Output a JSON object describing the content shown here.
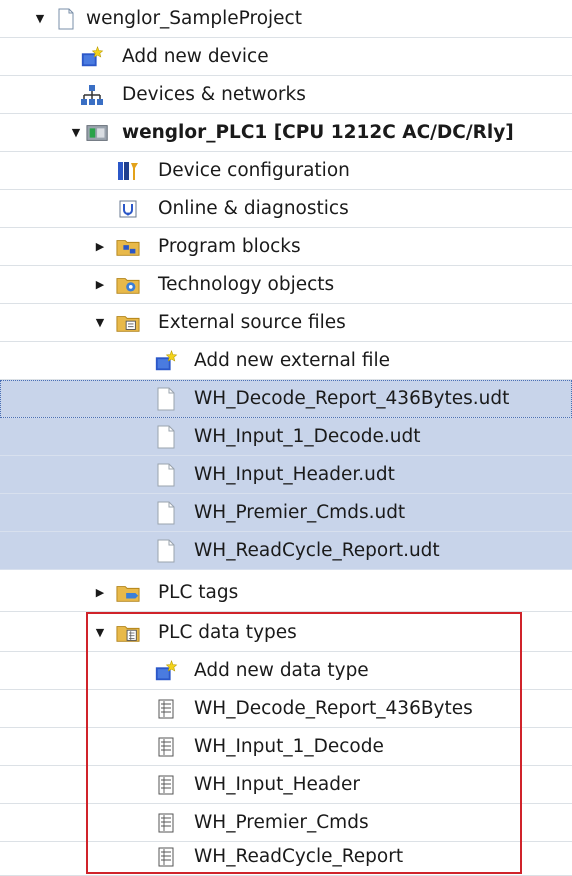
{
  "tree": {
    "project": "wenglor_SampleProject",
    "add_new_device": "Add new device",
    "devices_networks": "Devices & networks",
    "plc": "wenglor_PLC1 [CPU 1212C AC/DC/Rly]",
    "device_configuration": "Device configuration",
    "online_diagnostics": "Online & diagnostics",
    "program_blocks": "Program blocks",
    "technology_objects": "Technology objects",
    "external_source_files": "External source files",
    "add_new_external_file": "Add new external file",
    "external_files": [
      "WH_Decode_Report_436Bytes.udt",
      "WH_Input_1_Decode.udt",
      "WH_Input_Header.udt",
      "WH_Premier_Cmds.udt",
      "WH_ReadCycle_Report.udt"
    ],
    "plc_tags": "PLC tags",
    "plc_data_types": "PLC data types",
    "add_new_data_type": "Add new data type",
    "data_types": [
      "WH_Decode_Report_436Bytes",
      "WH_Input_1_Decode",
      "WH_Input_Header",
      "WH_Premier_Cmds",
      "WH_ReadCycle_Report"
    ]
  },
  "colors": {
    "selection": "#c8d4ea",
    "highlight_box": "#d0232a",
    "folder": "#e8b94a"
  }
}
